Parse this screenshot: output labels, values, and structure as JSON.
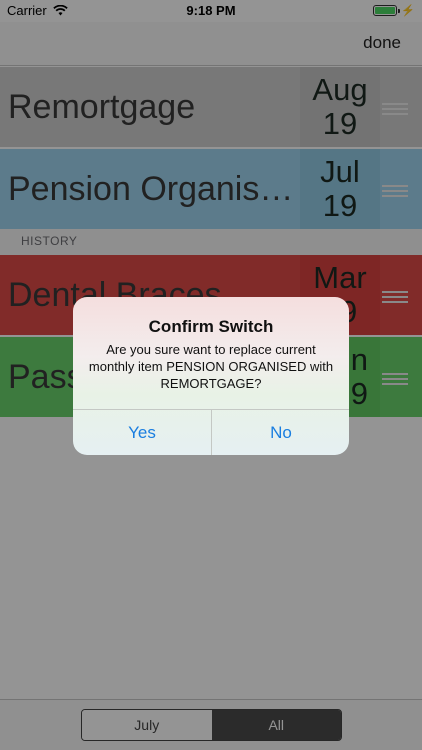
{
  "status_bar": {
    "carrier": "Carrier",
    "time": "9:18 PM",
    "battery_level": 1.0,
    "icons": [
      "wifi-icon",
      "battery-icon",
      "charging-bolt-icon"
    ]
  },
  "nav": {
    "done_label": "done"
  },
  "current_items": [
    {
      "title": "Remortgage",
      "month": "Aug",
      "year": "19",
      "color": "#cfcfcf"
    },
    {
      "title": "Pension Organis…",
      "month": "Jul",
      "year": "19",
      "color": "#9fd5ef"
    }
  ],
  "history_header": "HISTORY",
  "history_items": [
    {
      "title": "Dental Braces",
      "month": "Mar",
      "year": "19",
      "color": "#de4a47"
    },
    {
      "title": "Pass",
      "month": "n",
      "year": "9",
      "color": "#6ad26b"
    }
  ],
  "alert": {
    "title": "Confirm Switch",
    "message": "Are you sure want to replace current monthly item PENSION ORGANISED with  REMORTGAGE?",
    "yes_label": "Yes",
    "no_label": "No",
    "accent_color": "#1a7ee0"
  },
  "toolbar": {
    "segments": [
      "July",
      "All"
    ],
    "selected": "All"
  }
}
